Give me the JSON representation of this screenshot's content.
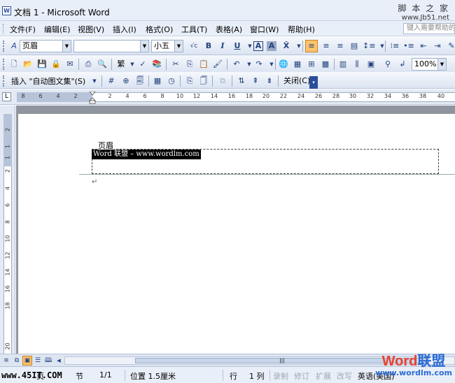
{
  "window": {
    "title": "文档 1 - Microsoft Word",
    "icon": "word-doc-icon"
  },
  "watermarks": {
    "top_cn": "脚 本 之 家",
    "top_url": "www.Jb51.net",
    "bottom_left": "www.45IT.COM",
    "bottom_right_word": "Word",
    "bottom_right_cn": "联盟",
    "bottom_right_url": "www.wordlm.com"
  },
  "menu": {
    "items": [
      "文件(F)",
      "编辑(E)",
      "视图(V)",
      "插入(I)",
      "格式(O)",
      "工具(T)",
      "表格(A)",
      "窗口(W)",
      "帮助(H)"
    ],
    "help_search_placeholder": "键入需要帮助的"
  },
  "format_toolbar": {
    "style_value": "页眉",
    "font_value": "",
    "size_value": "小五",
    "bold": "B",
    "italic": "I",
    "underline": "U",
    "char_border": "A",
    "char_shading": "A"
  },
  "standard_toolbar": {
    "trad_simp": "繁",
    "zoom_value": "100%"
  },
  "header_footer_toolbar": {
    "insert_autotext_label": "插入 \"自动图文集\"(S)",
    "close_label": "关闭(C)"
  },
  "ruler": {
    "h_numbers": [
      "8",
      "6",
      "4",
      "2",
      "2",
      "4",
      "6",
      "8",
      "10",
      "12",
      "14",
      "16",
      "18",
      "20",
      "22",
      "24",
      "26",
      "28",
      "30",
      "32",
      "34",
      "36",
      "38",
      "40"
    ],
    "v_numbers": [
      "2",
      "1",
      "1",
      "2",
      "4",
      "6",
      "8",
      "10",
      "12",
      "14",
      "16",
      "18",
      "20"
    ],
    "tab_selector": "L"
  },
  "document": {
    "header_label": "页眉",
    "header_text": "Word 联盟 – www.wordlm.com",
    "paragraph_mark": "↵"
  },
  "status": {
    "page": "页",
    "section": "节",
    "page_of": "1/1",
    "position": "位置 1.5厘米",
    "line": "行",
    "column": "1 列",
    "rec": "录制",
    "trk": "修订",
    "ext": "扩展",
    "ovr": "改写",
    "language": "英语(美国)"
  },
  "colors": {
    "active_button": "#ffc46a",
    "toolbar_bg": "#dbe4f2",
    "doc_bg": "#8f959c"
  }
}
